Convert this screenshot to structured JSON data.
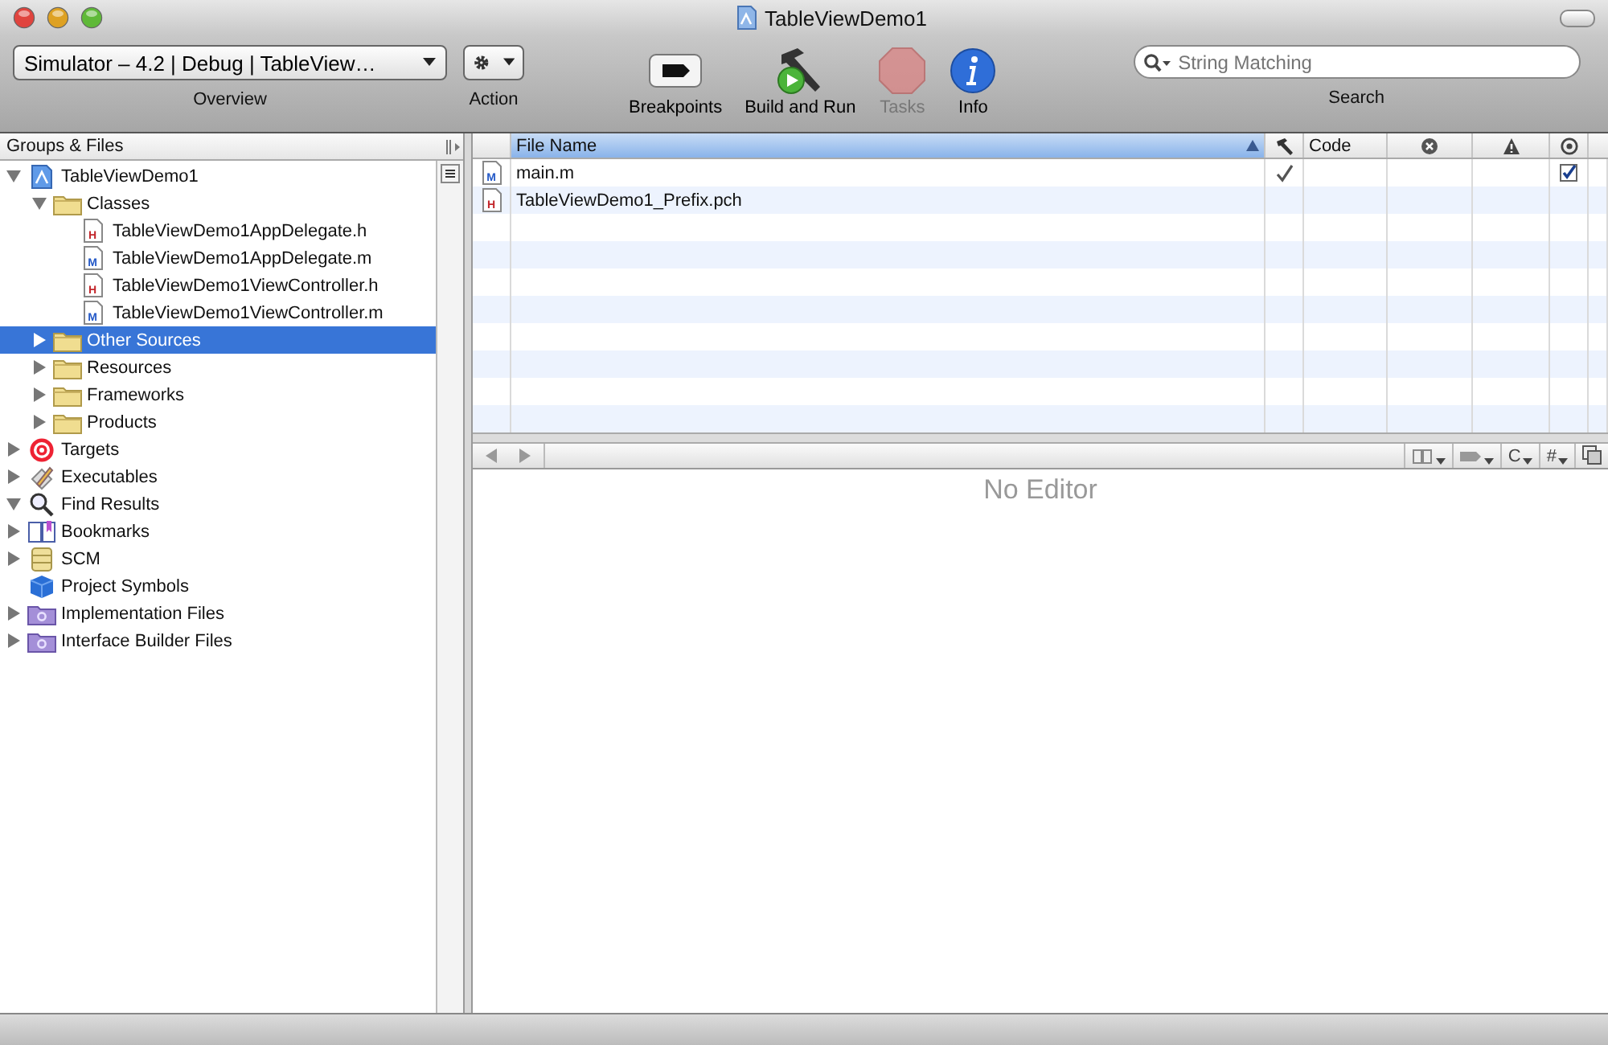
{
  "window": {
    "title": "TableViewDemo1"
  },
  "toolbar": {
    "scheme_popup": {
      "value": "Simulator – 4.2 | Debug | TableView…",
      "label": "Overview"
    },
    "action": {
      "label": "Action"
    },
    "items": [
      {
        "kind": "breakpoints",
        "label": "Breakpoints",
        "disabled": false
      },
      {
        "kind": "build",
        "label": "Build and Run",
        "disabled": false
      },
      {
        "kind": "tasks",
        "label": "Tasks",
        "disabled": true
      },
      {
        "kind": "info",
        "label": "Info",
        "disabled": false
      }
    ],
    "search": {
      "placeholder": "String Matching",
      "label": "Search"
    }
  },
  "sidebar": {
    "header": "Groups & Files",
    "items": [
      {
        "label": "TableViewDemo1",
        "kind": "project",
        "expanded": true,
        "selected": false,
        "children": [
          {
            "label": "Classes",
            "kind": "folder",
            "expanded": true,
            "selected": false,
            "children": [
              {
                "label": "TableViewDemo1AppDelegate.h",
                "kind": "h",
                "badge": "H",
                "selected": false
              },
              {
                "label": "TableViewDemo1AppDelegate.m",
                "kind": "m",
                "badge": "M",
                "selected": false
              },
              {
                "label": "TableViewDemo1ViewController.h",
                "kind": "h",
                "badge": "H",
                "selected": false
              },
              {
                "label": "TableViewDemo1ViewController.m",
                "kind": "m",
                "badge": "M",
                "selected": false
              }
            ]
          },
          {
            "label": "Other Sources",
            "kind": "folder",
            "expanded": false,
            "selected": true
          },
          {
            "label": "Resources",
            "kind": "folder",
            "expanded": false,
            "selected": false
          },
          {
            "label": "Frameworks",
            "kind": "folder",
            "expanded": false,
            "selected": false
          },
          {
            "label": "Products",
            "kind": "folder",
            "expanded": false,
            "selected": false
          }
        ]
      },
      {
        "label": "Targets",
        "kind": "target",
        "expanded": false,
        "selected": false
      },
      {
        "label": "Executables",
        "kind": "executable",
        "expanded": false,
        "selected": false
      },
      {
        "label": "Find Results",
        "kind": "find",
        "expanded": true,
        "selected": false
      },
      {
        "label": "Bookmarks",
        "kind": "bookmarks",
        "expanded": false,
        "selected": false
      },
      {
        "label": "SCM",
        "kind": "scm",
        "expanded": false,
        "selected": false
      },
      {
        "label": "Project Symbols",
        "kind": "symbols",
        "selected": false
      },
      {
        "label": "Implementation Files",
        "kind": "smart",
        "expanded": false,
        "selected": false
      },
      {
        "label": "Interface Builder Files",
        "kind": "smart",
        "expanded": false,
        "selected": false
      }
    ]
  },
  "table": {
    "columns": [
      {
        "kind": "text",
        "label": "File Name",
        "sorted": true
      },
      {
        "kind": "build"
      },
      {
        "kind": "text",
        "label": "Code",
        "sorted": false
      },
      {
        "kind": "errors"
      },
      {
        "kind": "warnings"
      },
      {
        "kind": "target"
      }
    ],
    "rows": [
      {
        "kind": "m",
        "badge": "M",
        "name": "main.m",
        "build": true,
        "target": true
      },
      {
        "kind": "h",
        "badge": "H",
        "name": "TableViewDemo1_Prefix.pch",
        "build": false,
        "target": false
      }
    ]
  },
  "editor": {
    "menus": [
      {
        "kind": "bookmark"
      },
      {
        "kind": "breakpoint"
      },
      {
        "kind": "text",
        "label": "C"
      },
      {
        "kind": "text",
        "label": "#"
      },
      {
        "kind": "split"
      }
    ],
    "message": "No Editor"
  }
}
